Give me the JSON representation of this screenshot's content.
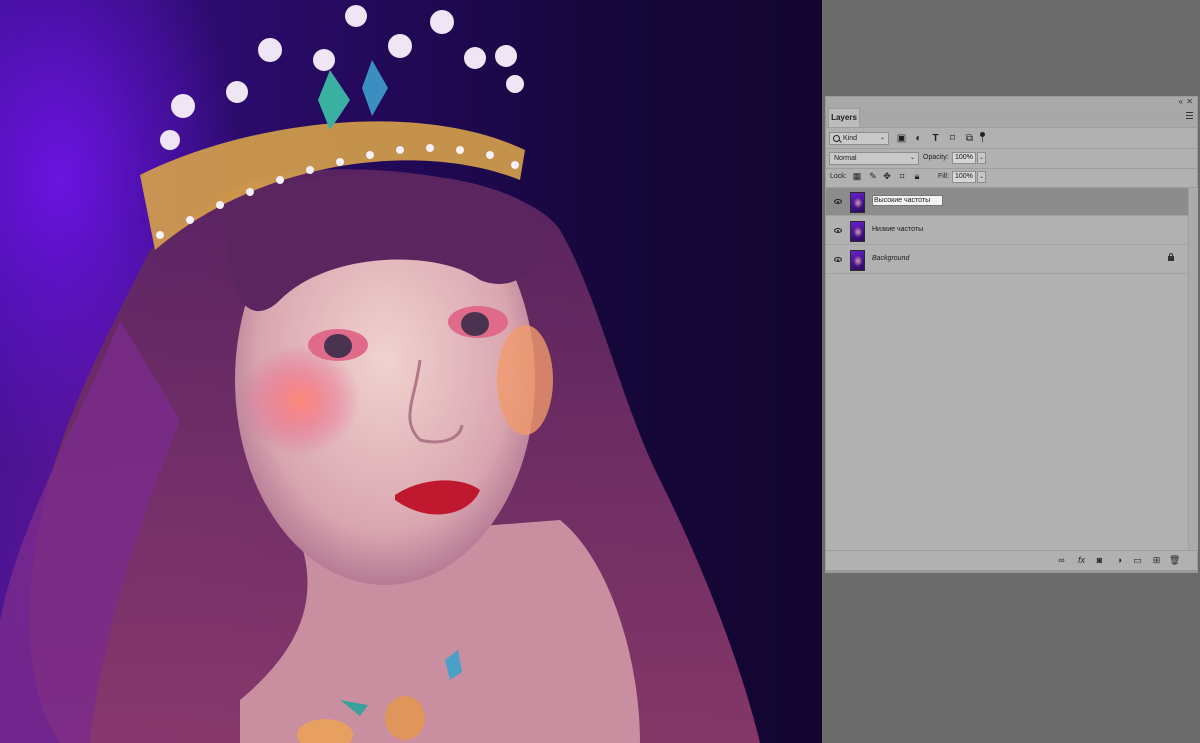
{
  "panel": {
    "tab_label": "Layers",
    "filter": {
      "kind_label": "Kind",
      "icons": [
        "pixel-filter-icon",
        "adjustment-filter-icon",
        "type-filter-icon",
        "shape-filter-icon",
        "smart-object-filter-icon"
      ]
    },
    "blend_mode": "Normal",
    "opacity_label": "Opacity:",
    "opacity_value": "100%",
    "lock_label": "Lock:",
    "fill_label": "Fill:",
    "fill_value": "100%",
    "layers": [
      {
        "name": "Высокие частоты",
        "selected": true,
        "editing": true,
        "locked": false
      },
      {
        "name": "Низкие частоты",
        "selected": false,
        "editing": false,
        "locked": false
      },
      {
        "name": "Background",
        "selected": false,
        "editing": false,
        "locked": true
      }
    ],
    "footer_icons": [
      "link-layers-icon",
      "fx-icon",
      "add-mask-icon",
      "adjustment-layer-icon",
      "new-group-icon",
      "new-layer-icon",
      "delete-icon"
    ],
    "fx_label": "fx"
  },
  "colors": {
    "panel_bg": "#b1b1b1",
    "selected_row": "#8c8c8c",
    "workspace": "#6b6b6b",
    "canvas_purple": "#3a0f8a"
  }
}
